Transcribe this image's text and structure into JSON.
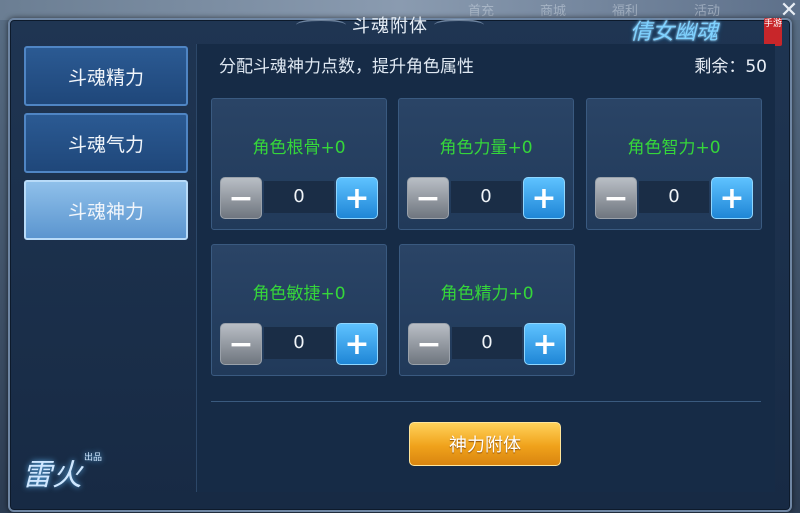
{
  "background": {
    "menu_items": [
      "首充",
      "商城",
      "福利",
      "活动"
    ]
  },
  "title": "斗魂附体",
  "logo": {
    "text": "倩女幽魂",
    "seal": "手游"
  },
  "sidebar": {
    "tabs": [
      {
        "label": "斗魂精力",
        "active": false
      },
      {
        "label": "斗魂气力",
        "active": false
      },
      {
        "label": "斗魂神力",
        "active": true
      }
    ],
    "publisher_logo": "雷火",
    "publisher_suffix": "出品"
  },
  "content": {
    "description": "分配斗魂神力点数，提升角色属性",
    "remaining_label": "剩余：",
    "remaining_value": "50",
    "attributes": [
      {
        "label": "角色根骨+0",
        "value": "0"
      },
      {
        "label": "角色力量+0",
        "value": "0"
      },
      {
        "label": "角色智力+0",
        "value": "0"
      },
      {
        "label": "角色敏捷+0",
        "value": "0"
      },
      {
        "label": "角色精力+0",
        "value": "0"
      }
    ],
    "stepper_minus": "−",
    "stepper_plus": "+",
    "confirm_label": "神力附体"
  },
  "colors": {
    "attribute_text": "#35d63a",
    "confirm_button": "#f0a21b",
    "plus_button": "#1f86d6"
  },
  "icons": {
    "close": "close-icon",
    "minus": "minus-icon",
    "plus": "plus-icon"
  }
}
